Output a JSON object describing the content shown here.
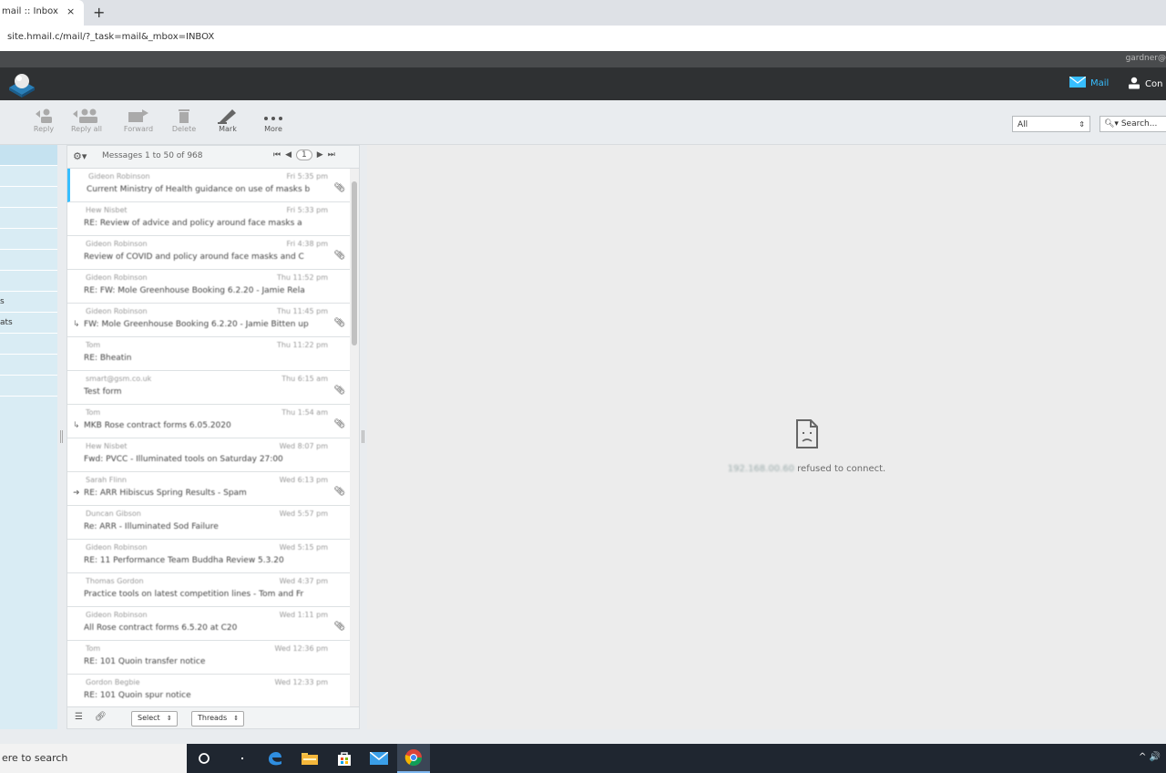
{
  "browser": {
    "tab_title": "mail :: Inbox",
    "tab_close": "×",
    "new_tab": "+",
    "url": "site.hmail.c/mail/?_task=mail&_mbox=INBOX"
  },
  "header": {
    "username": "gardner@",
    "nav_mail": "Mail",
    "nav_contacts": "Con"
  },
  "toolbar": {
    "buttons": [
      {
        "label": "Reply",
        "icon": "reply-icon"
      },
      {
        "label": "Reply all",
        "icon": "reply-all-icon"
      },
      {
        "label": "Forward",
        "icon": "forward-icon"
      },
      {
        "label": "Delete",
        "icon": "delete-icon"
      },
      {
        "label": "Mark",
        "icon": "mark-icon"
      },
      {
        "label": "More",
        "icon": "more-icon"
      }
    ],
    "filter_value": "All",
    "search_placeholder": "Search..."
  },
  "folders": [
    "",
    "",
    "",
    "",
    "",
    "",
    "",
    "s",
    "ats",
    "",
    "",
    ""
  ],
  "message_list": {
    "count_text": "Messages 1 to 50 of 968",
    "page": "1",
    "messages": [
      {
        "from": "Gideon Robinson",
        "date": "Fri 5:35 pm",
        "subject": "Current Ministry of Health guidance on use of masks b",
        "flag": "",
        "attach": true
      },
      {
        "from": "Hew Nisbet",
        "date": "Fri 5:33 pm",
        "subject": "RE: Review of advice and policy around face masks a",
        "flag": "",
        "attach": false
      },
      {
        "from": "Gideon Robinson",
        "date": "Fri 4:38 pm",
        "subject": "Review of COVID and policy around face masks and C",
        "flag": "",
        "attach": true
      },
      {
        "from": "Gideon Robinson",
        "date": "Thu 11:52 pm",
        "subject": "RE: FW: Mole Greenhouse Booking 6.2.20 - Jamie Rela",
        "flag": "",
        "attach": false
      },
      {
        "from": "Gideon Robinson",
        "date": "Thu 11:45 pm",
        "subject": "FW: Mole Greenhouse Booking 6.2.20 - Jamie Bitten up",
        "flag": "↳",
        "attach": true
      },
      {
        "from": "Tom",
        "date": "Thu 11:22 pm",
        "subject": "RE: Bheatin",
        "flag": "",
        "attach": false
      },
      {
        "from": "smart@gsm.co.uk",
        "date": "Thu 6:15 am",
        "subject": "Test form",
        "flag": "",
        "attach": true
      },
      {
        "from": "Tom",
        "date": "Thu 1:54 am",
        "subject": "MKB Rose contract forms 6.05.2020",
        "flag": "↳",
        "attach": true
      },
      {
        "from": "Hew Nisbet",
        "date": "Wed 8:07 pm",
        "subject": "Fwd: PVCC - Illuminated tools on Saturday 27:00",
        "flag": "",
        "attach": false
      },
      {
        "from": "Sarah Flinn",
        "date": "Wed 6:13 pm",
        "subject": "RE: ARR Hibiscus Spring Results - Spam",
        "flag": "➜",
        "attach": true
      },
      {
        "from": "Duncan Gibson",
        "date": "Wed 5:57 pm",
        "subject": "Re: ARR - Illuminated Sod Failure",
        "flag": "",
        "attach": false
      },
      {
        "from": "Gideon Robinson",
        "date": "Wed 5:15 pm",
        "subject": "RE: 11 Performance Team Buddha Review 5.3.20",
        "flag": "",
        "attach": false
      },
      {
        "from": "Thomas Gordon",
        "date": "Wed 4:37 pm",
        "subject": "Practice tools on latest competition lines - Tom and Fr",
        "flag": "",
        "attach": false
      },
      {
        "from": "Gideon Robinson",
        "date": "Wed 1:11 pm",
        "subject": "All Rose contract forms 6.5.20 at C20",
        "flag": "",
        "attach": true
      },
      {
        "from": "Tom",
        "date": "Wed 12:36 pm",
        "subject": "RE: 101 Quoin transfer notice",
        "flag": "",
        "attach": false
      },
      {
        "from": "Gordon Begbie",
        "date": "Wed 12:33 pm",
        "subject": "RE: 101 Quoin spur notice",
        "flag": "",
        "attach": false
      }
    ],
    "footer_select": "Select",
    "footer_threads": "Threads"
  },
  "preview": {
    "error_host": "192.168.00.60",
    "error_text": " refused to connect."
  },
  "taskbar": {
    "search_text": "ere to search",
    "tray": "^ 🔊"
  },
  "colors": {
    "header_bg": "#2f3133",
    "folder_bg": "#d9ecf4",
    "selected_marker": "#37beff",
    "taskbar_bg": "#1f2630"
  }
}
